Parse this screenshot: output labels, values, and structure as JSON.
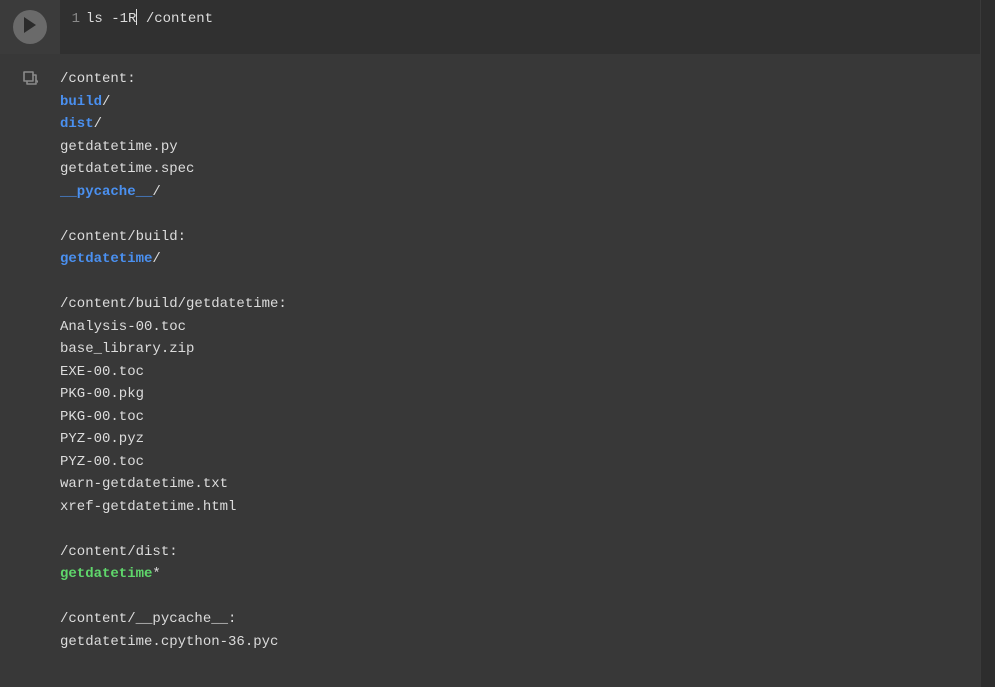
{
  "cell": {
    "line_number": "1",
    "code_seg1": "ls -1R",
    "code_seg2": " /content"
  },
  "output": {
    "lines": [
      {
        "segs": [
          {
            "t": "/content:",
            "c": ""
          }
        ]
      },
      {
        "segs": [
          {
            "t": "build",
            "c": "dir"
          },
          {
            "t": "/",
            "c": ""
          }
        ]
      },
      {
        "segs": [
          {
            "t": "dist",
            "c": "dir"
          },
          {
            "t": "/",
            "c": ""
          }
        ]
      },
      {
        "segs": [
          {
            "t": "getdatetime.py",
            "c": ""
          }
        ]
      },
      {
        "segs": [
          {
            "t": "getdatetime.spec",
            "c": ""
          }
        ]
      },
      {
        "segs": [
          {
            "t": "__pycache__",
            "c": "dir"
          },
          {
            "t": "/",
            "c": ""
          }
        ]
      },
      {
        "segs": [
          {
            "t": "",
            "c": ""
          }
        ]
      },
      {
        "segs": [
          {
            "t": "/content/build:",
            "c": ""
          }
        ]
      },
      {
        "segs": [
          {
            "t": "getdatetime",
            "c": "dir"
          },
          {
            "t": "/",
            "c": ""
          }
        ]
      },
      {
        "segs": [
          {
            "t": "",
            "c": ""
          }
        ]
      },
      {
        "segs": [
          {
            "t": "/content/build/getdatetime:",
            "c": ""
          }
        ]
      },
      {
        "segs": [
          {
            "t": "Analysis-00.toc",
            "c": ""
          }
        ]
      },
      {
        "segs": [
          {
            "t": "base_library.zip",
            "c": ""
          }
        ]
      },
      {
        "segs": [
          {
            "t": "EXE-00.toc",
            "c": ""
          }
        ]
      },
      {
        "segs": [
          {
            "t": "PKG-00.pkg",
            "c": ""
          }
        ]
      },
      {
        "segs": [
          {
            "t": "PKG-00.toc",
            "c": ""
          }
        ]
      },
      {
        "segs": [
          {
            "t": "PYZ-00.pyz",
            "c": ""
          }
        ]
      },
      {
        "segs": [
          {
            "t": "PYZ-00.toc",
            "c": ""
          }
        ]
      },
      {
        "segs": [
          {
            "t": "warn-getdatetime.txt",
            "c": ""
          }
        ]
      },
      {
        "segs": [
          {
            "t": "xref-getdatetime.html",
            "c": ""
          }
        ]
      },
      {
        "segs": [
          {
            "t": "",
            "c": ""
          }
        ]
      },
      {
        "segs": [
          {
            "t": "/content/dist:",
            "c": ""
          }
        ]
      },
      {
        "segs": [
          {
            "t": "getdatetime",
            "c": "exe"
          },
          {
            "t": "*",
            "c": ""
          }
        ]
      },
      {
        "segs": [
          {
            "t": "",
            "c": ""
          }
        ]
      },
      {
        "segs": [
          {
            "t": "/content/__pycache__:",
            "c": ""
          }
        ]
      },
      {
        "segs": [
          {
            "t": "getdatetime.cpython-36.pyc",
            "c": ""
          }
        ]
      }
    ]
  }
}
